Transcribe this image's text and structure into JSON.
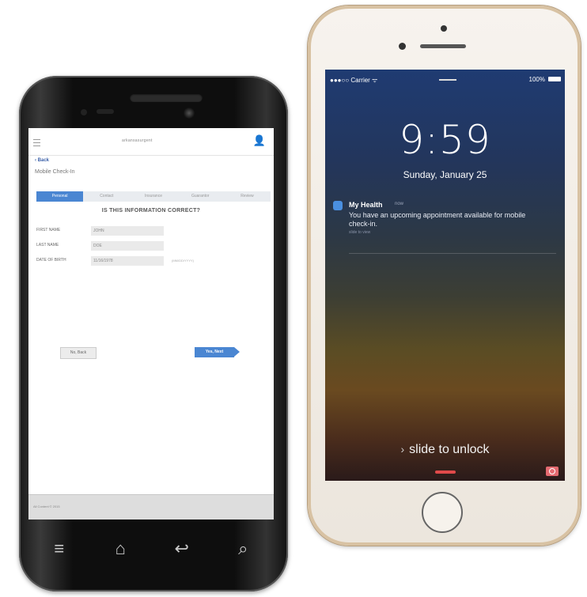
{
  "android": {
    "header": {
      "logo": "arkansasurgent",
      "menu_icon": "menu-icon",
      "user_icon": "user-icon"
    },
    "back_label": "‹ Back",
    "page_title": "Mobile Check-In",
    "steps": [
      "Personal",
      "Contact",
      "Insurance",
      "Guarantor",
      "Review"
    ],
    "question": "IS THIS INFORMATION CORRECT?",
    "fields": {
      "first_name": {
        "label": "FIRST NAME",
        "value": "JOHN"
      },
      "last_name": {
        "label": "LAST NAME",
        "value": "DOE"
      },
      "dob": {
        "label": "DATE OF BIRTH",
        "value": "11/16/1978",
        "hint": "(MM/DD/YYYY)"
      }
    },
    "buttons": {
      "no": "No, Back",
      "yes": "Yes, Next"
    },
    "footer_text": "All Content © 2015",
    "nav_icons": [
      "≡",
      "⌂",
      "↩",
      "⌕"
    ]
  },
  "iphone": {
    "status": {
      "carrier": "●●●○○ Carrier ᯤ",
      "battery": "100%"
    },
    "time": "9:59",
    "date": "Sunday, January 25",
    "notification": {
      "app": "My Health",
      "when": "now",
      "body": "You have an upcoming appointment available for mobile check-in.",
      "hint": "slide to view"
    },
    "slide_text": "slide to unlock",
    "slide_arrow": "›"
  }
}
